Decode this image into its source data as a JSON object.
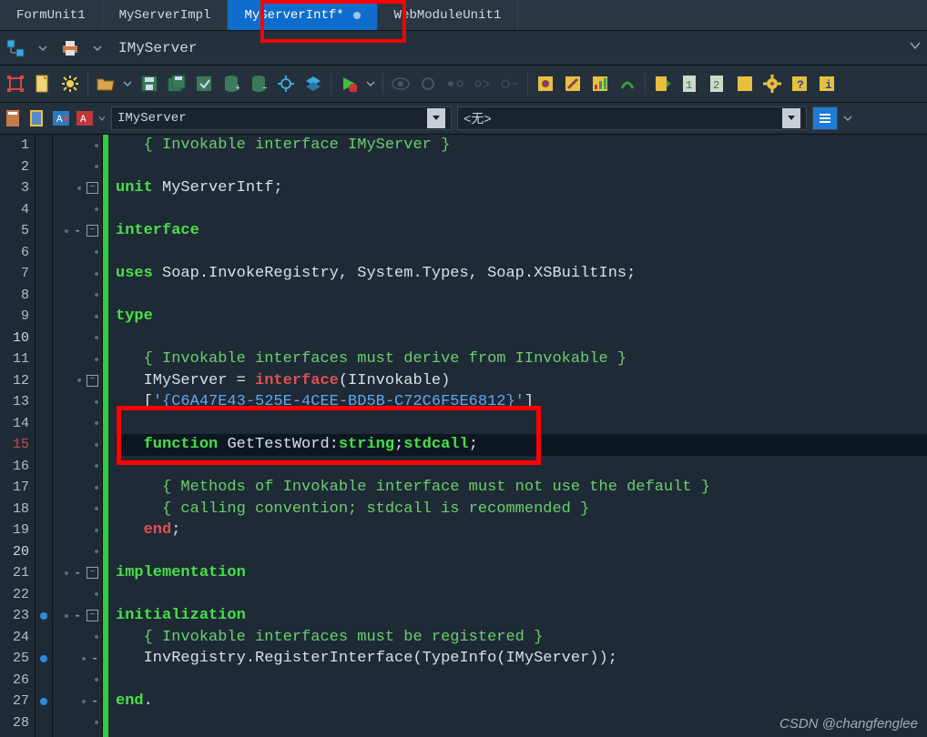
{
  "tabs": [
    {
      "label": "FormUnit1",
      "active": false
    },
    {
      "label": "MyServerImpl",
      "active": false
    },
    {
      "label": "MyServerIntf*",
      "active": true,
      "modified": true
    },
    {
      "label": "WebModuleUnit1",
      "active": false
    }
  ],
  "classbar": {
    "label": "IMyServer"
  },
  "navrow": {
    "class_combo": "IMyServer",
    "method_combo": "<无>"
  },
  "code": {
    "lines": [
      {
        "n": 1,
        "fold": "none",
        "html": "   <span class='cmt'>{ Invokable interface IMyServer }</span>"
      },
      {
        "n": 2,
        "fold": "none",
        "html": ""
      },
      {
        "n": 3,
        "fold": "box",
        "html": "<span class='kw'>unit</span> <span class='id'>MyServerIntf;</span>"
      },
      {
        "n": 4,
        "fold": "none",
        "html": ""
      },
      {
        "n": 5,
        "fold": "box",
        "dash": true,
        "html": "<span class='kw'>interface</span>"
      },
      {
        "n": 6,
        "fold": "none",
        "html": ""
      },
      {
        "n": 7,
        "fold": "none",
        "html": "<span class='kw'>uses</span> <span class='id'>Soap.InvokeRegistry, System.Types, Soap.XSBuiltIns;</span>"
      },
      {
        "n": 8,
        "fold": "none",
        "html": ""
      },
      {
        "n": 9,
        "fold": "none",
        "html": "<span class='kw'>type</span>"
      },
      {
        "n": 10,
        "fold": "none",
        "milestone": 10,
        "html": ""
      },
      {
        "n": 11,
        "fold": "none",
        "html": "   <span class='cmt'>{ Invokable interfaces must derive from IInvokable }</span>"
      },
      {
        "n": 12,
        "fold": "box",
        "html": "   <span class='id'>IMyServer = </span><span class='kw2'>interface</span><span class='id'>(IInvokable)</span>"
      },
      {
        "n": 13,
        "fold": "none",
        "html": "   <span class='id'>[</span><span class='str'>'{C6A47E43-525E-4CEE-BD5B-C72C6F5E6812}'</span><span class='id'>]</span>"
      },
      {
        "n": 14,
        "fold": "none",
        "html": ""
      },
      {
        "n": 15,
        "fold": "none",
        "red": true,
        "milestone": 15,
        "cur": true,
        "html": "   <span class='kw'>function</span> <span class='id'>GetTestWord:</span><span class='kw'>string</span><span class='id'>;</span><span class='kw'>stdcall</span><span class='id'>;</span>"
      },
      {
        "n": 16,
        "fold": "none",
        "html": ""
      },
      {
        "n": 17,
        "fold": "none",
        "html": "     <span class='cmt'>{ Methods of Invokable interface must not use the default }</span>"
      },
      {
        "n": 18,
        "fold": "none",
        "html": "     <span class='cmt'>{ calling convention; stdcall is recommended }</span>"
      },
      {
        "n": 19,
        "fold": "none",
        "html": "   <span class='kw2'>end</span><span class='id'>;</span>"
      },
      {
        "n": 20,
        "fold": "none",
        "milestone": 20,
        "html": ""
      },
      {
        "n": 21,
        "fold": "box",
        "dash": true,
        "html": "<span class='kw'>implementation</span>"
      },
      {
        "n": 22,
        "fold": "none",
        "html": ""
      },
      {
        "n": 23,
        "fold": "box",
        "dash": true,
        "bp": true,
        "html": "<span class='kw'>initialization</span>"
      },
      {
        "n": 24,
        "fold": "none",
        "html": "   <span class='cmt'>{ Invokable interfaces must be registered }</span>"
      },
      {
        "n": 25,
        "fold": "none",
        "dash": true,
        "bp": true,
        "html": "   <span class='id'>InvRegistry.RegisterInterface(TypeInfo(IMyServer));</span>"
      },
      {
        "n": 26,
        "fold": "none",
        "html": ""
      },
      {
        "n": 27,
        "fold": "none",
        "dash": true,
        "bp": true,
        "html": "<span class='kw'>end</span><span class='id'>.</span>"
      },
      {
        "n": 28,
        "fold": "none",
        "html": ""
      }
    ]
  },
  "watermark": "CSDN @changfenglee"
}
